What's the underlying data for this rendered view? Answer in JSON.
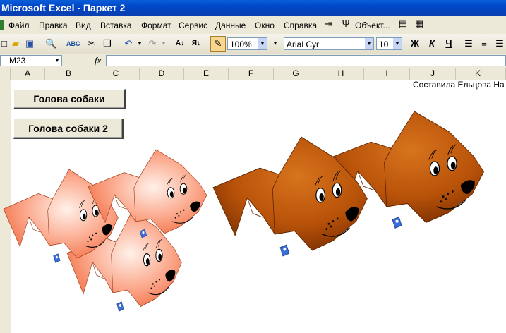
{
  "window": {
    "title": "Microsoft Excel - Паркет 2"
  },
  "menu": {
    "items": [
      "Файл",
      "Правка",
      "Вид",
      "Вставка",
      "Формат",
      "Сервис",
      "Данные",
      "Окно",
      "Справка"
    ],
    "object_label": "Объект..."
  },
  "toolbar": {
    "zoom": "100%",
    "font_name": "Arial Cyr",
    "font_size": "10",
    "bold_label": "Ж",
    "italic_label": "К",
    "underline_label": "Ч"
  },
  "formula_bar": {
    "name_box": "M23",
    "fx_label": "fx",
    "value": ""
  },
  "columns": [
    "A",
    "B",
    "C",
    "D",
    "E",
    "F",
    "G",
    "H",
    "I",
    "J",
    "K"
  ],
  "sheet": {
    "button1_label": "Голова собаки",
    "button2_label": "Голова собаки 2",
    "credit_text": "Составила Ельцова На"
  },
  "colors": {
    "title_bar": "#0046c8",
    "pink_dog": "#f58a6a",
    "brown_dog": "#c25a0a",
    "collar_tag": "#3b6fd8"
  }
}
